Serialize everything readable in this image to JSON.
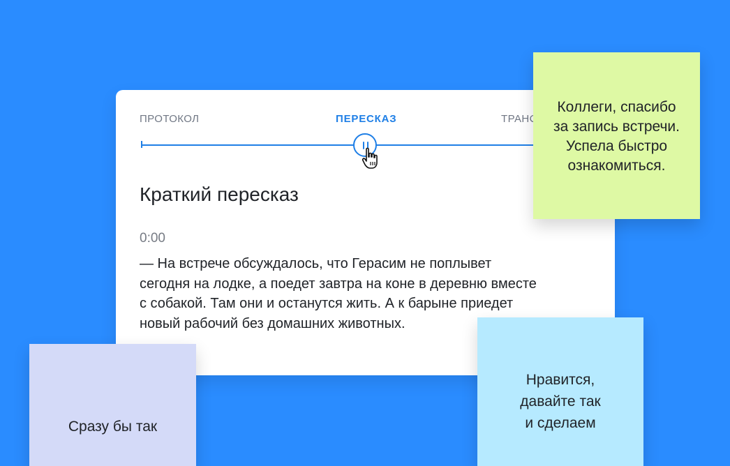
{
  "tabs": [
    {
      "label": "ПРОТОКОЛ",
      "active": false
    },
    {
      "label": "ПЕРЕСКАЗ",
      "active": true
    },
    {
      "label": "ТРАНСКРИПТ",
      "active": false
    }
  ],
  "player": {
    "icon": "pause-icon",
    "cursor_icon": "hand-pointer-icon"
  },
  "content": {
    "heading": "Краткий пересказ",
    "timestamp": "0:00",
    "summary": "— На встрече обсуждалось, что Герасим не поплывет\nсегодня на лодке, а поедет завтра на коне в деревню вместе\nс собакой. Там они и останутся жить. А к барыне приедет\nновый рабочий без домашних животных."
  },
  "notes": {
    "green": "Коллеги, спасибо\nза запись встречи.\nУспела быстро\nознакомиться.",
    "purple": "Сразу бы так",
    "blue": "Нравится,\nдавайте так\nи сделаем"
  },
  "colors": {
    "background": "#2a8cff",
    "accent": "#1f7fe6",
    "note_green": "#def9a4",
    "note_purple": "#d4daf8",
    "note_blue": "#b6eaff"
  }
}
